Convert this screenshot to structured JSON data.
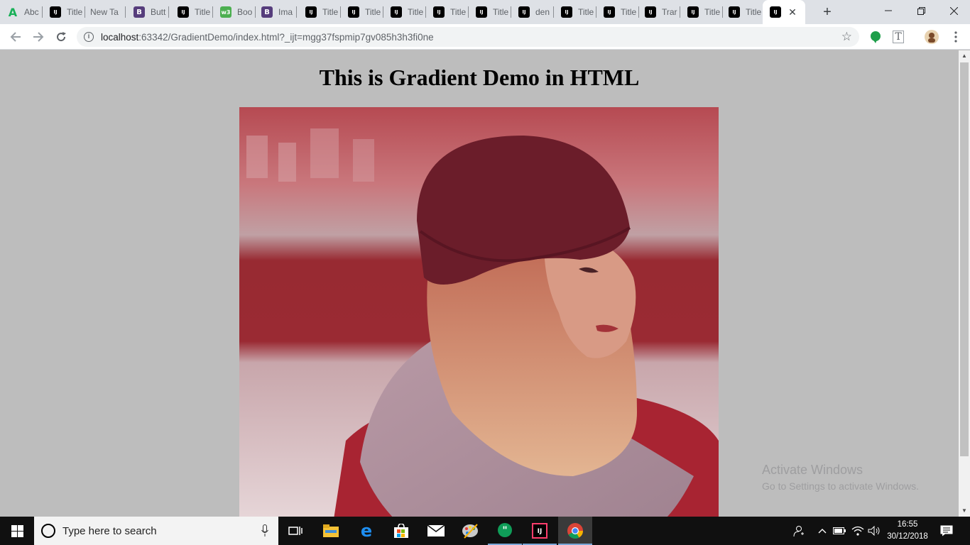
{
  "browser": {
    "tabs": [
      {
        "title": "Abc",
        "favicon": "a-icon"
      },
      {
        "title": "Title",
        "favicon": "intellij-icon"
      },
      {
        "title": "New Tab",
        "favicon": "none"
      },
      {
        "title": "Butt",
        "favicon": "bootstrap-icon"
      },
      {
        "title": "Title",
        "favicon": "intellij-icon"
      },
      {
        "title": "Boo",
        "favicon": "w3schools-icon"
      },
      {
        "title": "Ima",
        "favicon": "bootstrap-icon"
      },
      {
        "title": "Title",
        "favicon": "intellij-icon"
      },
      {
        "title": "Title",
        "favicon": "intellij-icon"
      },
      {
        "title": "Title",
        "favicon": "intellij-icon"
      },
      {
        "title": "Title",
        "favicon": "intellij-icon"
      },
      {
        "title": "Title",
        "favicon": "intellij-icon"
      },
      {
        "title": "den",
        "favicon": "intellij-icon"
      },
      {
        "title": "Title",
        "favicon": "intellij-icon"
      },
      {
        "title": "Title",
        "favicon": "intellij-icon"
      },
      {
        "title": "Trar",
        "favicon": "intellij-icon"
      },
      {
        "title": "Title",
        "favicon": "intellij-icon"
      },
      {
        "title": "Title",
        "favicon": "intellij-icon"
      },
      {
        "title": "",
        "favicon": "intellij-icon",
        "active": true
      }
    ],
    "address": {
      "host": "localhost",
      "path": ":63342/GradientDemo/index.html?_ijt=mgg37fspmip7gv085h3h3fi0ne"
    }
  },
  "page": {
    "heading": "This is Gradient Demo in HTML",
    "image_description_icon": "photo-icon",
    "overlay_color": "#b4323c"
  },
  "watermark": {
    "line1": "Activate Windows",
    "line2": "Go to Settings to activate Windows."
  },
  "taskbar": {
    "search_placeholder": "Type here to search",
    "time": "16:55",
    "date": "30/12/2018"
  }
}
